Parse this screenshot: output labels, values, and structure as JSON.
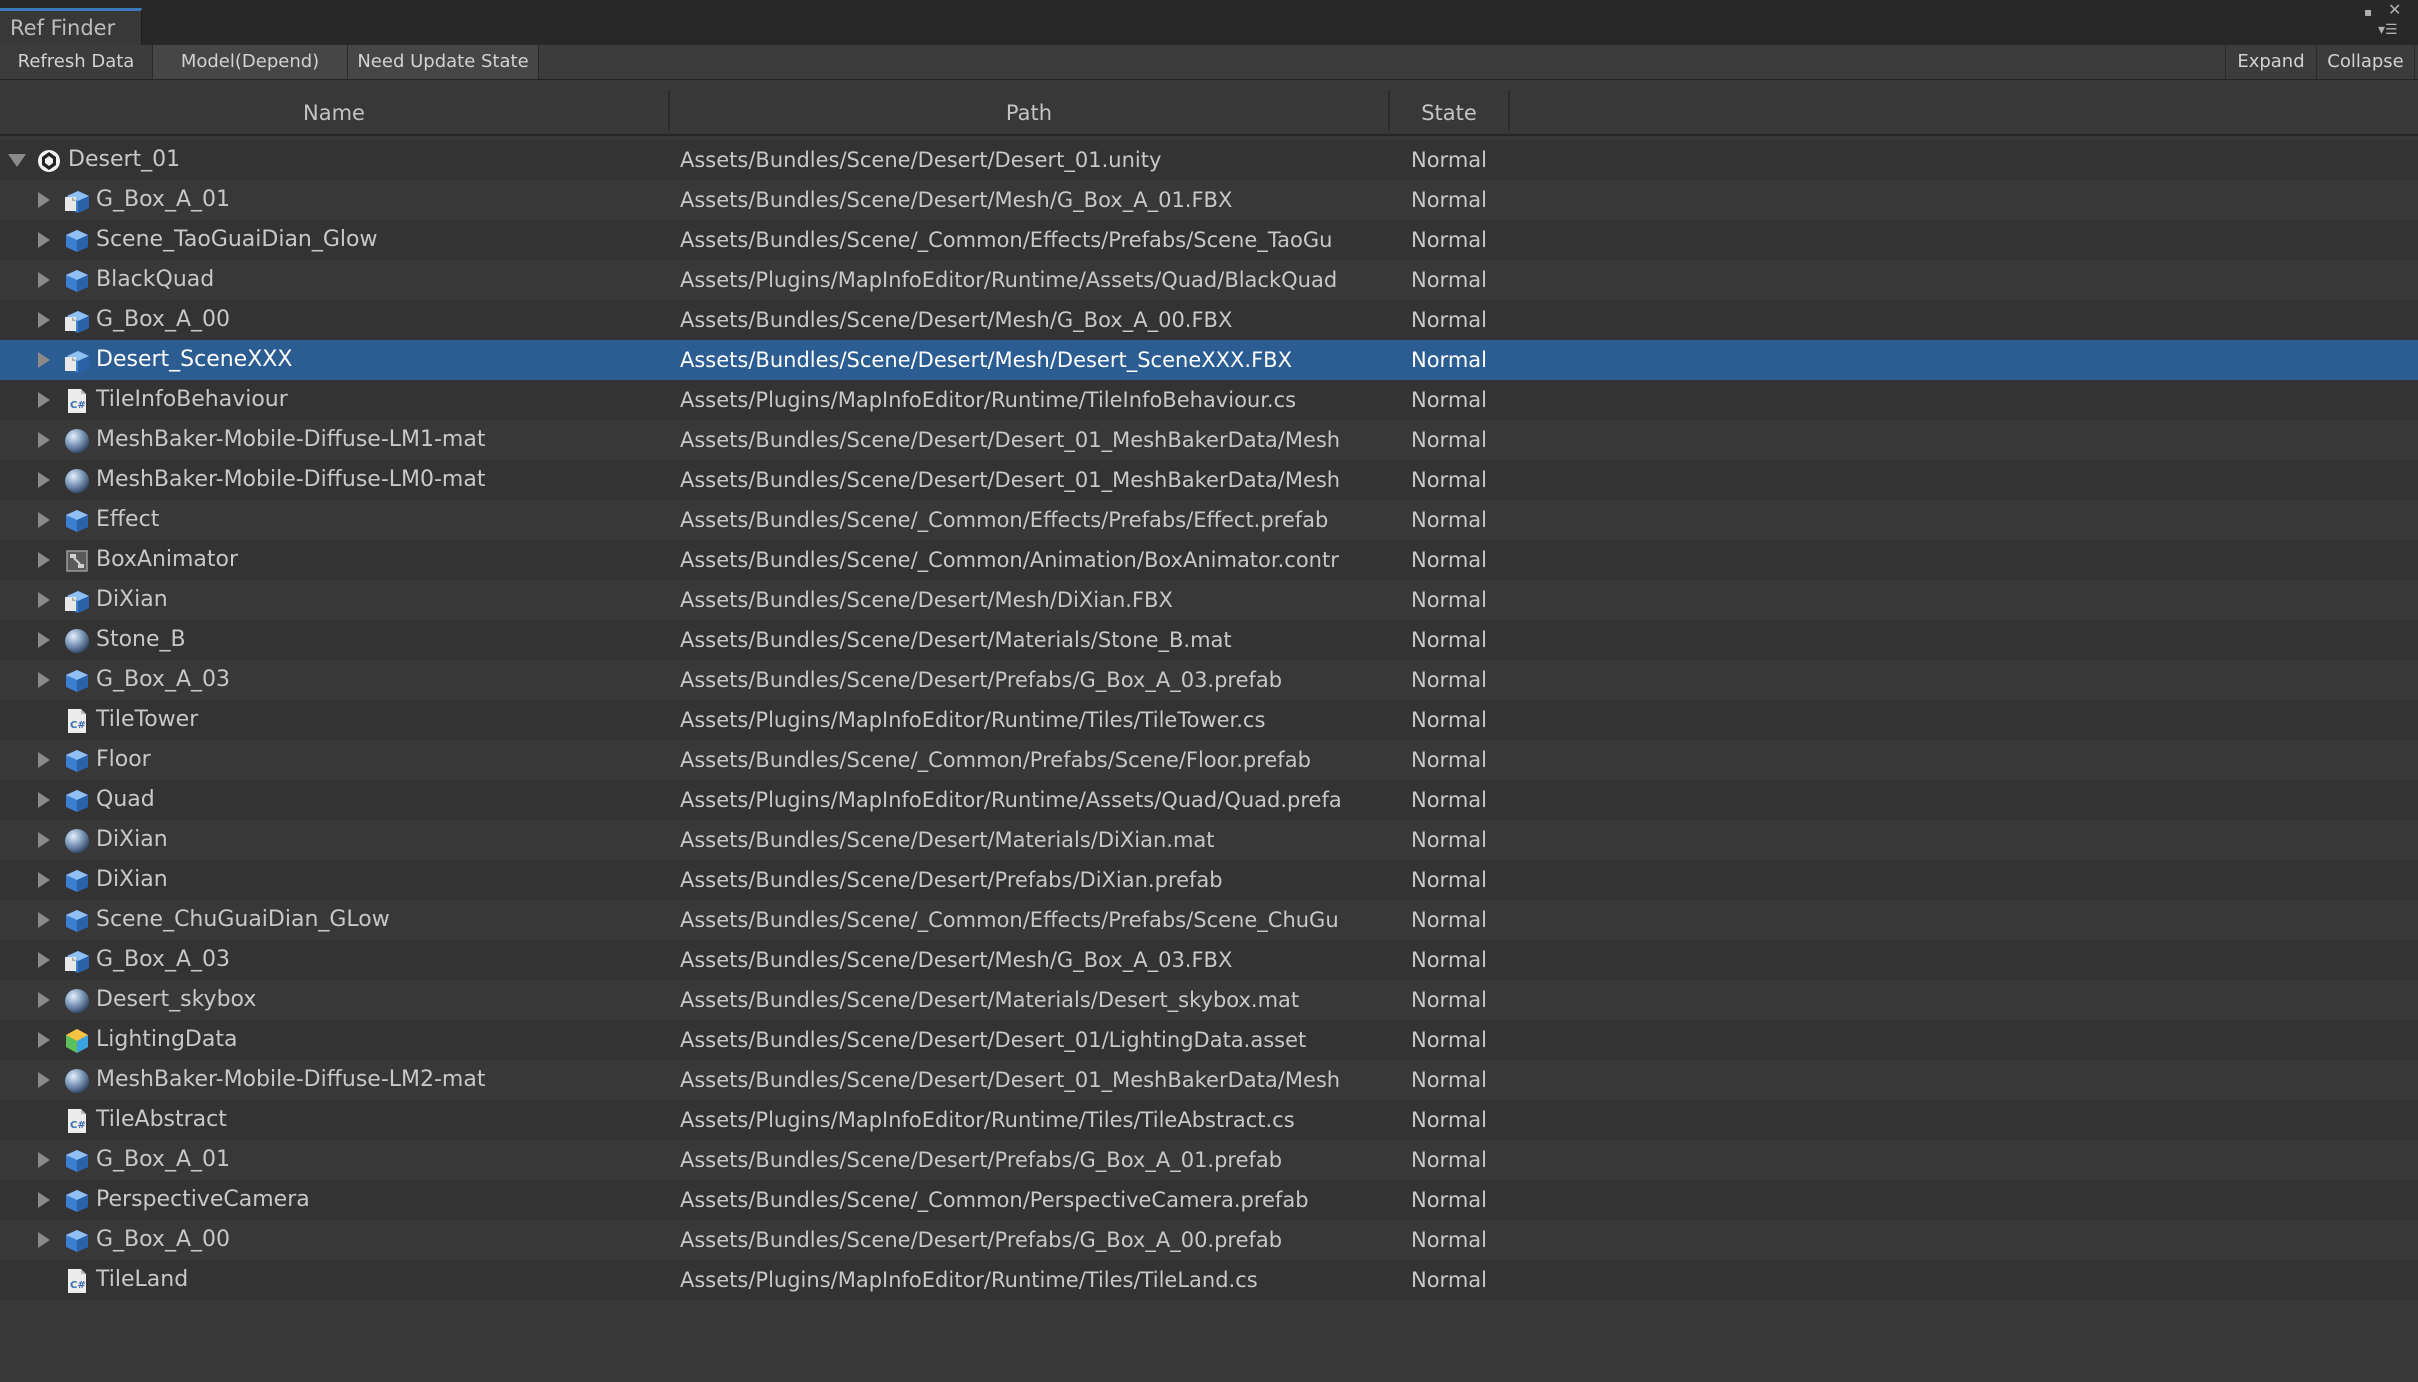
{
  "window": {
    "tab_title": "Ref Finder",
    "maximize_glyph": "▪",
    "close_glyph": "✕",
    "menu_glyph": "▾☰"
  },
  "toolbar": {
    "refresh": "Refresh Data",
    "mode": "Model(Depend)",
    "need_update": "Need Update State",
    "expand": "Expand",
    "collapse": "Collapse"
  },
  "columns": {
    "name": "Name",
    "path": "Path",
    "state": "State"
  },
  "colors": {
    "selection": "#2c5d92",
    "accent": "#3a79bb",
    "background": "#383838"
  },
  "rows": [
    {
      "name": "Desert_01",
      "path": "Assets/Bundles/Scene/Desert/Desert_01.unity",
      "state": "Normal",
      "icon": "unity-scene-icon",
      "depth": 0,
      "expanded": true,
      "has_children": true
    },
    {
      "name": "G_Box_A_01",
      "path": "Assets/Bundles/Scene/Desert/Mesh/G_Box_A_01.FBX",
      "state": "Normal",
      "icon": "model-icon",
      "depth": 1,
      "has_children": true
    },
    {
      "name": "Scene_TaoGuaiDian_Glow",
      "path": "Assets/Bundles/Scene/_Common/Effects/Prefabs/Scene_TaoGu",
      "state": "Normal",
      "icon": "prefab-icon",
      "depth": 1,
      "has_children": true
    },
    {
      "name": "BlackQuad",
      "path": "Assets/Plugins/MapInfoEditor/Runtime/Assets/Quad/BlackQuad",
      "state": "Normal",
      "icon": "prefab-icon",
      "depth": 1,
      "has_children": true
    },
    {
      "name": "G_Box_A_00",
      "path": "Assets/Bundles/Scene/Desert/Mesh/G_Box_A_00.FBX",
      "state": "Normal",
      "icon": "model-icon",
      "depth": 1,
      "has_children": true
    },
    {
      "name": "Desert_SceneXXX",
      "path": "Assets/Bundles/Scene/Desert/Mesh/Desert_SceneXXX.FBX",
      "state": "Normal",
      "icon": "model-icon",
      "depth": 1,
      "has_children": true,
      "selected": true
    },
    {
      "name": "TileInfoBehaviour",
      "path": "Assets/Plugins/MapInfoEditor/Runtime/TileInfoBehaviour.cs",
      "state": "Normal",
      "icon": "csharp-script-icon",
      "depth": 1,
      "has_children": true
    },
    {
      "name": "MeshBaker-Mobile-Diffuse-LM1-mat",
      "path": "Assets/Bundles/Scene/Desert/Desert_01_MeshBakerData/Mesh",
      "state": "Normal",
      "icon": "material-sphere-icon",
      "depth": 1,
      "has_children": true
    },
    {
      "name": "MeshBaker-Mobile-Diffuse-LM0-mat",
      "path": "Assets/Bundles/Scene/Desert/Desert_01_MeshBakerData/Mesh",
      "state": "Normal",
      "icon": "material-sphere-icon",
      "depth": 1,
      "has_children": true
    },
    {
      "name": "Effect",
      "path": "Assets/Bundles/Scene/_Common/Effects/Prefabs/Effect.prefab",
      "state": "Normal",
      "icon": "prefab-icon",
      "depth": 1,
      "has_children": true
    },
    {
      "name": "BoxAnimator",
      "path": "Assets/Bundles/Scene/_Common/Animation/BoxAnimator.contr",
      "state": "Normal",
      "icon": "animator-controller-icon",
      "depth": 1,
      "has_children": true
    },
    {
      "name": "DiXian",
      "path": "Assets/Bundles/Scene/Desert/Mesh/DiXian.FBX",
      "state": "Normal",
      "icon": "model-icon",
      "depth": 1,
      "has_children": true
    },
    {
      "name": "Stone_B",
      "path": "Assets/Bundles/Scene/Desert/Materials/Stone_B.mat",
      "state": "Normal",
      "icon": "material-sphere-icon",
      "depth": 1,
      "has_children": true
    },
    {
      "name": "G_Box_A_03",
      "path": "Assets/Bundles/Scene/Desert/Prefabs/G_Box_A_03.prefab",
      "state": "Normal",
      "icon": "prefab-icon",
      "depth": 1,
      "has_children": true
    },
    {
      "name": "TileTower",
      "path": "Assets/Plugins/MapInfoEditor/Runtime/Tiles/TileTower.cs",
      "state": "Normal",
      "icon": "csharp-script-icon",
      "depth": 1,
      "has_children": false
    },
    {
      "name": "Floor",
      "path": "Assets/Bundles/Scene/_Common/Prefabs/Scene/Floor.prefab",
      "state": "Normal",
      "icon": "prefab-icon",
      "depth": 1,
      "has_children": true
    },
    {
      "name": "Quad",
      "path": "Assets/Plugins/MapInfoEditor/Runtime/Assets/Quad/Quad.prefa",
      "state": "Normal",
      "icon": "prefab-icon",
      "depth": 1,
      "has_children": true
    },
    {
      "name": "DiXian",
      "path": "Assets/Bundles/Scene/Desert/Materials/DiXian.mat",
      "state": "Normal",
      "icon": "material-sphere-icon",
      "depth": 1,
      "has_children": true
    },
    {
      "name": "DiXian",
      "path": "Assets/Bundles/Scene/Desert/Prefabs/DiXian.prefab",
      "state": "Normal",
      "icon": "prefab-icon",
      "depth": 1,
      "has_children": true
    },
    {
      "name": "Scene_ChuGuaiDian_GLow",
      "path": "Assets/Bundles/Scene/_Common/Effects/Prefabs/Scene_ChuGu",
      "state": "Normal",
      "icon": "prefab-icon",
      "depth": 1,
      "has_children": true
    },
    {
      "name": "G_Box_A_03",
      "path": "Assets/Bundles/Scene/Desert/Mesh/G_Box_A_03.FBX",
      "state": "Normal",
      "icon": "model-icon",
      "depth": 1,
      "has_children": true
    },
    {
      "name": "Desert_skybox",
      "path": "Assets/Bundles/Scene/Desert/Materials/Desert_skybox.mat",
      "state": "Normal",
      "icon": "material-sphere-icon",
      "depth": 1,
      "has_children": true
    },
    {
      "name": "LightingData",
      "path": "Assets/Bundles/Scene/Desert/Desert_01/LightingData.asset",
      "state": "Normal",
      "icon": "lighting-data-icon",
      "depth": 1,
      "has_children": true
    },
    {
      "name": "MeshBaker-Mobile-Diffuse-LM2-mat",
      "path": "Assets/Bundles/Scene/Desert/Desert_01_MeshBakerData/Mesh",
      "state": "Normal",
      "icon": "material-sphere-icon",
      "depth": 1,
      "has_children": true
    },
    {
      "name": "TileAbstract",
      "path": "Assets/Plugins/MapInfoEditor/Runtime/Tiles/TileAbstract.cs",
      "state": "Normal",
      "icon": "csharp-script-icon",
      "depth": 1,
      "has_children": false
    },
    {
      "name": "G_Box_A_01",
      "path": "Assets/Bundles/Scene/Desert/Prefabs/G_Box_A_01.prefab",
      "state": "Normal",
      "icon": "prefab-icon",
      "depth": 1,
      "has_children": true
    },
    {
      "name": "PerspectiveCamera",
      "path": "Assets/Bundles/Scene/_Common/PerspectiveCamera.prefab",
      "state": "Normal",
      "icon": "prefab-icon",
      "depth": 1,
      "has_children": true
    },
    {
      "name": "G_Box_A_00",
      "path": "Assets/Bundles/Scene/Desert/Prefabs/G_Box_A_00.prefab",
      "state": "Normal",
      "icon": "prefab-icon",
      "depth": 1,
      "has_children": true
    },
    {
      "name": "TileLand",
      "path": "Assets/Plugins/MapInfoEditor/Runtime/Tiles/TileLand.cs",
      "state": "Normal",
      "icon": "csharp-script-icon",
      "depth": 1,
      "has_children": false
    }
  ]
}
